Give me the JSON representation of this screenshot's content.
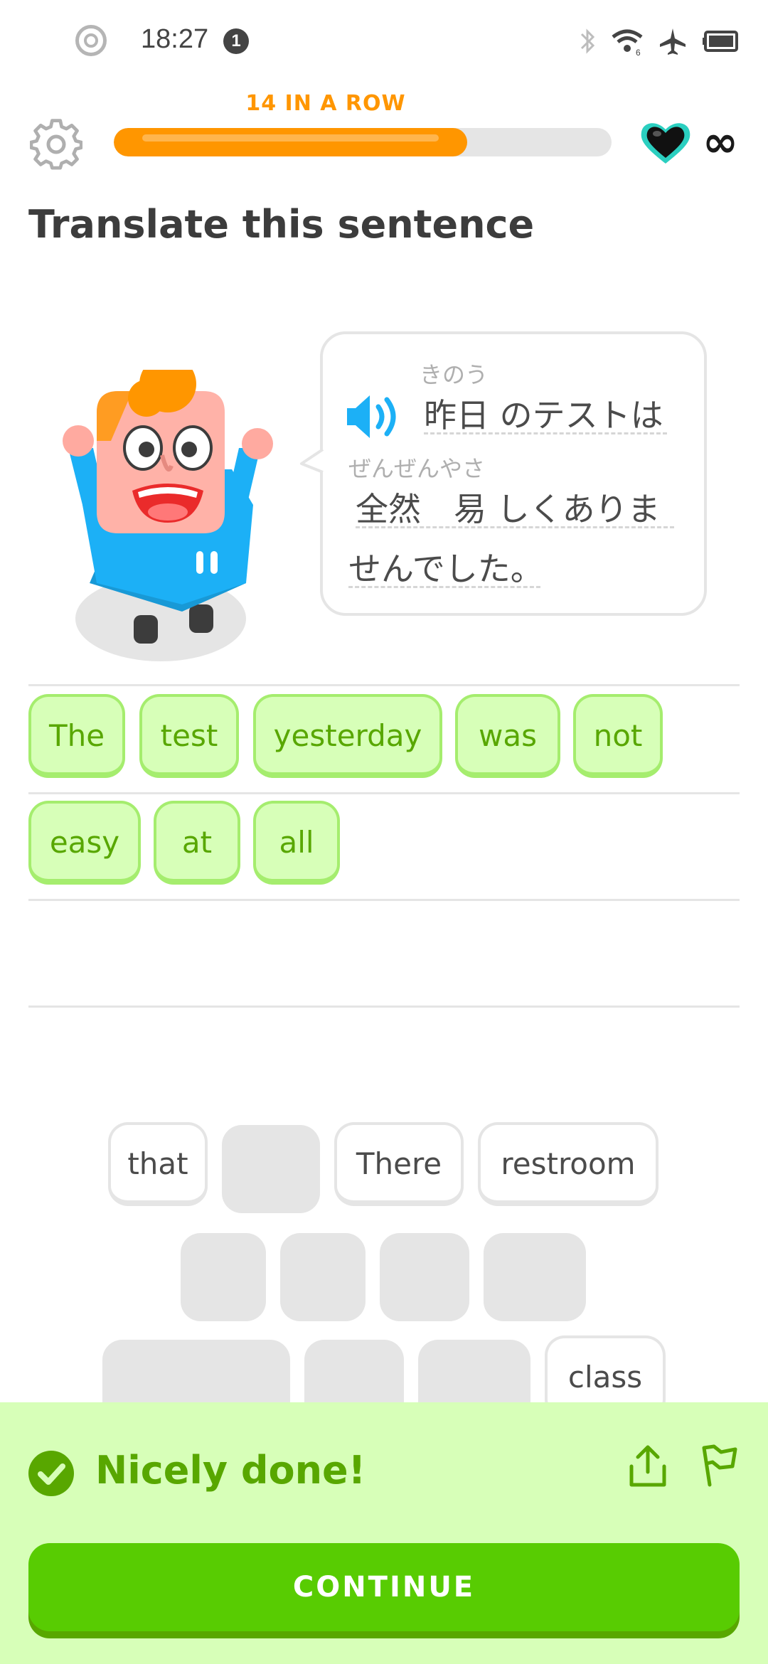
{
  "status_bar": {
    "time": "18:27",
    "notification_count": "1"
  },
  "header": {
    "streak_label": "14 IN A ROW",
    "progress": 0.71,
    "hearts": "∞"
  },
  "prompt": {
    "title": "Translate this sentence"
  },
  "sentence": {
    "line1_furigana": "きのう",
    "line1": "昨日 のテストは",
    "line2_furigana": "ぜんぜんやさ",
    "line2": "全然　易 しくありま",
    "line3": "せんでした。"
  },
  "answer_tiles": [
    "The",
    "test",
    "yesterday",
    "was",
    "not",
    "easy",
    "at",
    "all"
  ],
  "word_bank": {
    "row1": [
      "that",
      "",
      "There",
      "restroom"
    ],
    "row3_last": "class"
  },
  "feedback": {
    "message": "Nicely done!",
    "continue_label": "CONTINUE"
  },
  "colors": {
    "accent": "#58cc02",
    "correct_text": "#58a700",
    "streak": "#ff9600",
    "feedback_bg": "#d7ffb8"
  }
}
